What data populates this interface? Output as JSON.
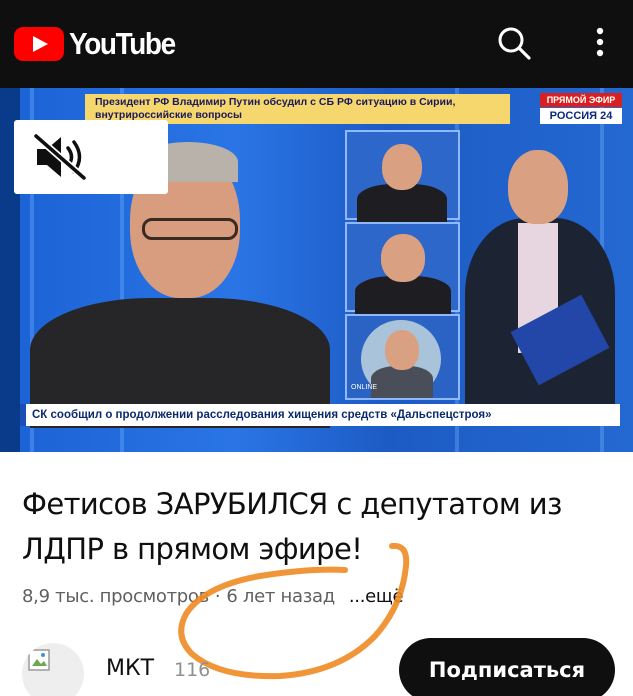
{
  "app": {
    "brand": "YouTube",
    "brand_color": "#ff0000",
    "topbar_color": "#0f0f0f"
  },
  "header": {
    "search_icon": "search-icon",
    "menu_icon": "more-vertical-icon"
  },
  "video": {
    "ticker_top": "Президент РФ Владимир Путин обсудил с СБ РФ ситуацию в Сирии, внутрироссийские вопросы",
    "live_badge": "ПРЯМОЙ ЭФИР",
    "channel_badge": "РОССИЯ 24",
    "online_label": "ONLINE",
    "ticker_bottom": "СК сообщил о продолжении расследования хищения средств «Дальспецстроя»",
    "mute_icon": "volume-muted-icon"
  },
  "details": {
    "title": "Фетисов ЗАРУБИЛСЯ с депутатом из ЛДПР в прямом эфире!",
    "views": "8,9 тыс. просмотров",
    "separator": "·",
    "age": "6 лет назад",
    "more": "...ещё"
  },
  "channel": {
    "name": "МКТ",
    "subscribers": "116",
    "subscribe_label": "Подписаться"
  },
  "annotation": {
    "color": "#f08a24"
  }
}
